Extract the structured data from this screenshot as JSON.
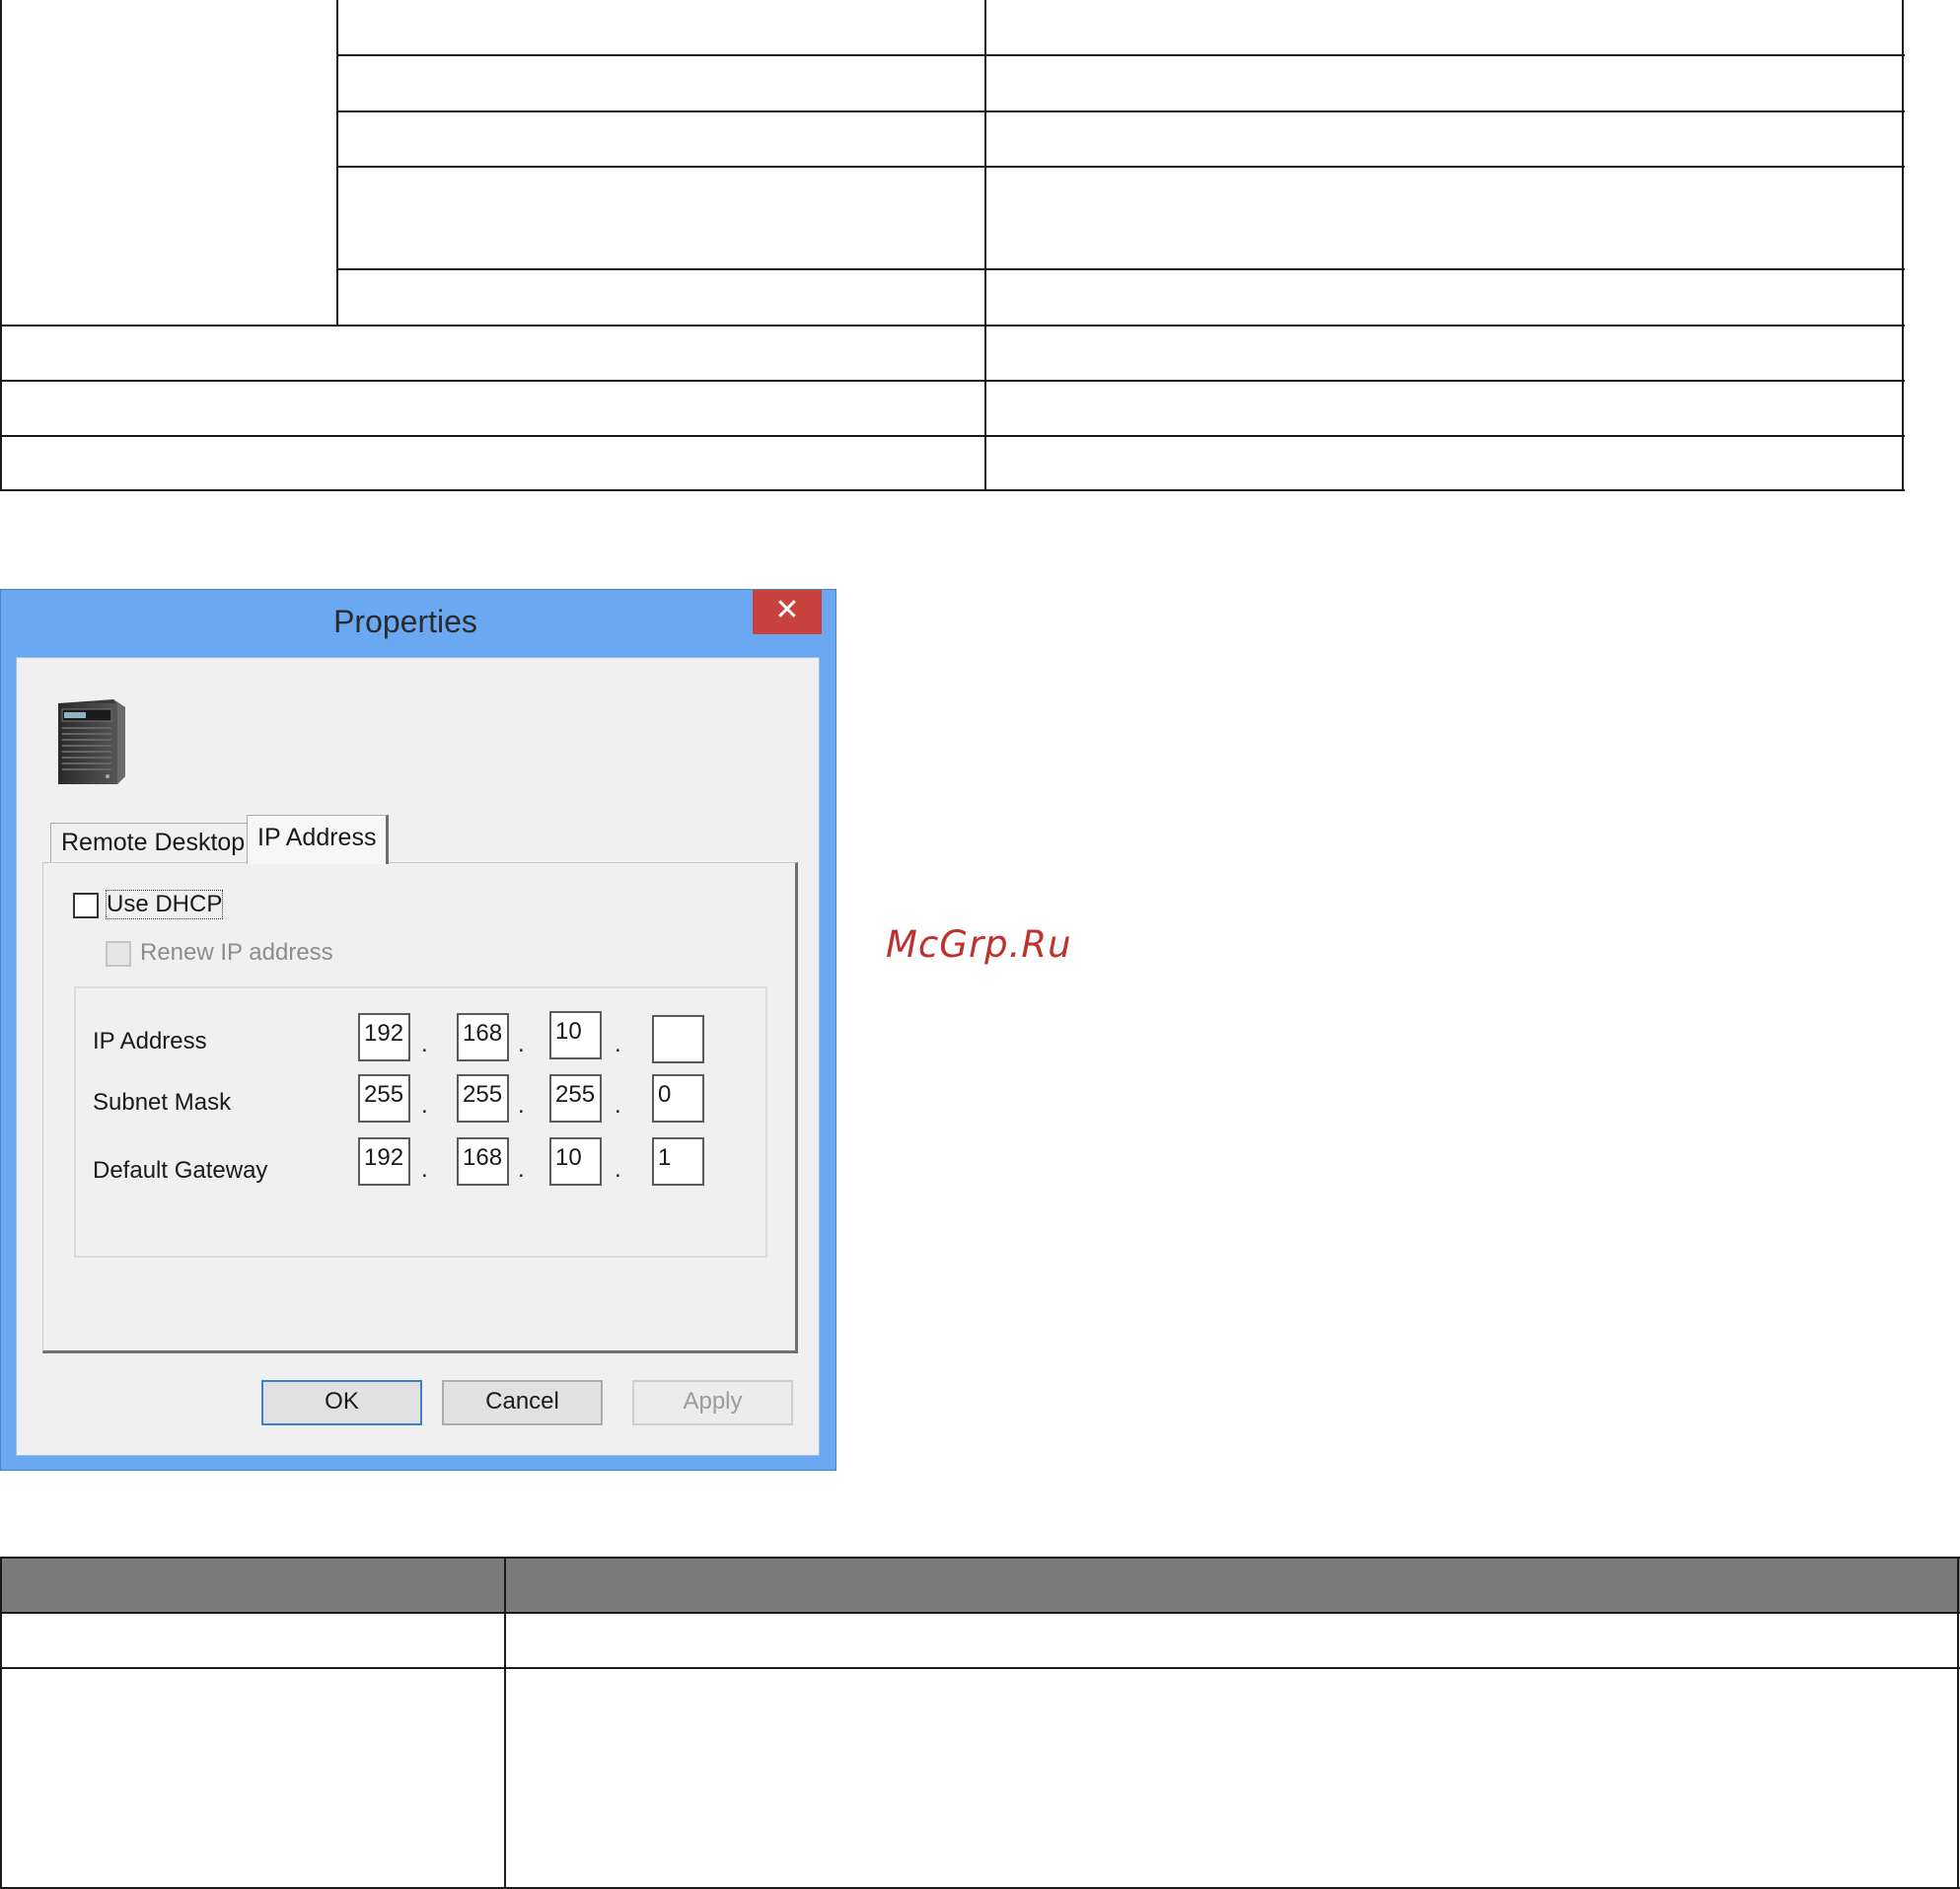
{
  "window": {
    "title": "Properties",
    "close_glyph": "✕"
  },
  "tabs": [
    {
      "label": "Remote Desktop",
      "active": false
    },
    {
      "label": "IP Address",
      "active": true
    }
  ],
  "dhcp": {
    "use_dhcp_label": "Use DHCP",
    "use_dhcp_checked": false,
    "renew_label": "Renew IP address",
    "renew_enabled": false
  },
  "fields": {
    "ip_address": {
      "label": "IP Address",
      "octets": [
        "192",
        "168",
        "10",
        ""
      ]
    },
    "subnet_mask": {
      "label": "Subnet Mask",
      "octets": [
        "255",
        "255",
        "255",
        "0"
      ]
    },
    "default_gateway": {
      "label": "Default Gateway",
      "octets": [
        "192",
        "168",
        "10",
        "1"
      ]
    }
  },
  "separator": ".",
  "buttons": {
    "ok": "OK",
    "cancel": "Cancel",
    "apply": "Apply"
  },
  "watermark": "McGrp.Ru",
  "icons": {
    "device": "nas-server-icon",
    "close": "close-icon"
  },
  "colors": {
    "titlebar": "#6aa9f2",
    "close": "#c9423d",
    "table_header": "#7c7b7b",
    "watermark": "#c0302c"
  }
}
